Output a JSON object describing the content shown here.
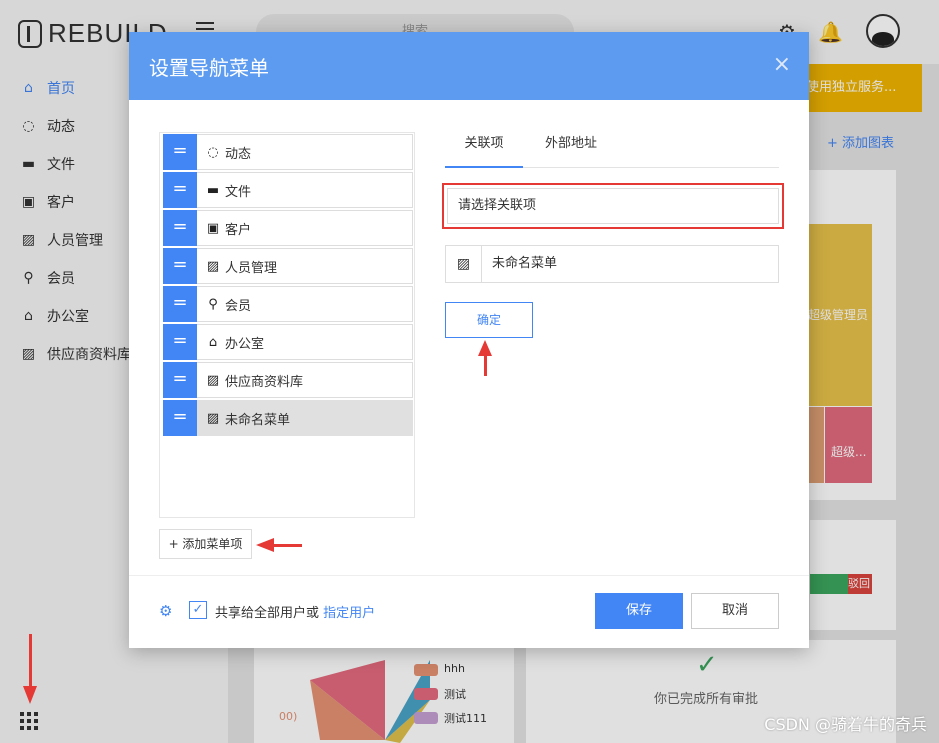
{
  "app": {
    "logo_text": "REBUILD",
    "search_placeholder": "搜索"
  },
  "sidebar": {
    "items": [
      {
        "label": "首页",
        "icon": "home-icon"
      },
      {
        "label": "动态",
        "icon": "refresh-circle-icon"
      },
      {
        "label": "文件",
        "icon": "folder-icon"
      },
      {
        "label": "客户",
        "icon": "id-card-icon"
      },
      {
        "label": "人员管理",
        "icon": "stripes-icon"
      },
      {
        "label": "会员",
        "icon": "bicycle-icon"
      },
      {
        "label": "办公室",
        "icon": "bank-icon"
      },
      {
        "label": "供应商资料库",
        "icon": "stripes-icon"
      }
    ]
  },
  "background": {
    "banner_text": "使用独立服务...",
    "add_chart": "+ 添加图表",
    "treemap_a": "超级管理员",
    "treemap_c": "超级...",
    "legend": [
      "hhh",
      "测试",
      "测试111"
    ],
    "pie_label": "00)",
    "approval_text": "你已完成所有审批",
    "progress_label": "驳回"
  },
  "modal": {
    "title": "设置导航菜单",
    "close": "×",
    "drag_glyph": "=",
    "menu_items": [
      {
        "label": "动态",
        "icon": "refresh-circle-icon"
      },
      {
        "label": "文件",
        "icon": "folder-icon"
      },
      {
        "label": "客户",
        "icon": "id-card-icon"
      },
      {
        "label": "人员管理",
        "icon": "stripes-icon"
      },
      {
        "label": "会员",
        "icon": "bicycle-icon"
      },
      {
        "label": "办公室",
        "icon": "bank-icon"
      },
      {
        "label": "供应商资料库",
        "icon": "stripes-icon"
      },
      {
        "label": "未命名菜单",
        "icon": "stripes-icon",
        "selected": true
      }
    ],
    "add_item": "+ 添加菜单项",
    "tabs": [
      "关联项",
      "外部地址"
    ],
    "select_placeholder": "请选择关联项",
    "name_value": "未命名菜单",
    "ok": "确定",
    "share_text": "共享给全部用户或",
    "share_link": "指定用户",
    "save": "保存",
    "cancel": "取消"
  },
  "watermark": "CSDN @骑着牛的奇兵",
  "colors": {
    "accent": "#4285f4",
    "header": "#5c9bf0",
    "highlight": "#e53935"
  }
}
